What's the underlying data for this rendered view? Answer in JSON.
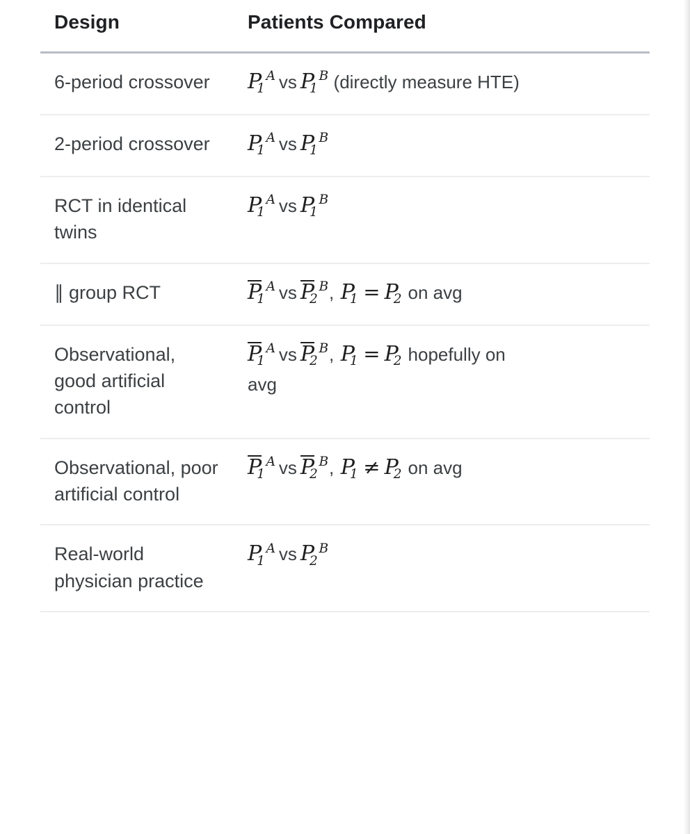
{
  "table": {
    "headers": {
      "design": "Design",
      "patients": "Patients Compared"
    },
    "rows": [
      {
        "design": "6-period crossover",
        "patients_text": "P_1^A vs P_1^B (directly measure HTE)",
        "left": {
          "base": "P",
          "sup": "A",
          "sub": "1",
          "bar": false
        },
        "vs": "vs",
        "right": {
          "base": "P",
          "sup": "B",
          "sub": "1",
          "bar": false
        },
        "note": "(directly measure HTE)",
        "relation": "",
        "rel_left": "",
        "rel_right": "",
        "tail": ""
      },
      {
        "design": "2-period crossover",
        "patients_text": "P_1^A vs P_1^B",
        "left": {
          "base": "P",
          "sup": "A",
          "sub": "1",
          "bar": false
        },
        "vs": "vs",
        "right": {
          "base": "P",
          "sup": "B",
          "sub": "1",
          "bar": false
        },
        "note": "",
        "relation": "",
        "rel_left": "",
        "rel_right": "",
        "tail": ""
      },
      {
        "design": "RCT in identical twins",
        "patients_text": "P_1^A vs P_1^B",
        "left": {
          "base": "P",
          "sup": "A",
          "sub": "1",
          "bar": false
        },
        "vs": "vs",
        "right": {
          "base": "P",
          "sup": "B",
          "sub": "1",
          "bar": false
        },
        "note": "",
        "relation": "",
        "rel_left": "",
        "rel_right": "",
        "tail": ""
      },
      {
        "design": "∥ group RCT",
        "patients_text": "P̄1^A vs P̄2^B, P_1 = P_2 on avg",
        "left": {
          "base": "P",
          "sup": "A",
          "sub": "1",
          "bar": true
        },
        "vs": "vs",
        "right": {
          "base": "P",
          "sup": "B",
          "sub": "2",
          "bar": true
        },
        "note": "",
        "relation": "=",
        "rel_left": "P",
        "rel_left_sub": "1",
        "rel_right": "P",
        "rel_right_sub": "2",
        "tail": "on avg"
      },
      {
        "design": "Observational, good artificial control",
        "patients_text": "P̄1^A vs P̄2^B, P_1 = P_2 hopefully on avg",
        "left": {
          "base": "P",
          "sup": "A",
          "sub": "1",
          "bar": true
        },
        "vs": "vs",
        "right": {
          "base": "P",
          "sup": "B",
          "sub": "2",
          "bar": true
        },
        "note": "",
        "relation": "=",
        "rel_left": "P",
        "rel_left_sub": "1",
        "rel_right": "P",
        "rel_right_sub": "2",
        "tail": "hopefully on",
        "tail2": "avg"
      },
      {
        "design": "Observational, poor artificial control",
        "patients_text": "P̄1^A vs P̄2^B, P_1 ≠ P_2 on avg",
        "left": {
          "base": "P",
          "sup": "A",
          "sub": "1",
          "bar": true
        },
        "vs": "vs",
        "right": {
          "base": "P",
          "sup": "B",
          "sub": "2",
          "bar": true
        },
        "note": "",
        "relation": "≠",
        "rel_left": "P",
        "rel_left_sub": "1",
        "rel_right": "P",
        "rel_right_sub": "2",
        "tail": "on avg"
      },
      {
        "design": "Real-world physician practice",
        "patients_text": "P_1^A vs P_2^B",
        "left": {
          "base": "P",
          "sup": "A",
          "sub": "1",
          "bar": false
        },
        "vs": "vs",
        "right": {
          "base": "P",
          "sup": "B",
          "sub": "2",
          "bar": false
        },
        "note": "",
        "relation": "",
        "rel_left": "",
        "rel_right": "",
        "tail": ""
      }
    ],
    "separator_comma": ","
  },
  "colors": {
    "header_text": "#202124",
    "body_text": "#3c4043",
    "math_text": "#1f1f1f",
    "header_rule": "#b7bdc5",
    "row_rule": "#ededed",
    "background": "#ffffff"
  }
}
